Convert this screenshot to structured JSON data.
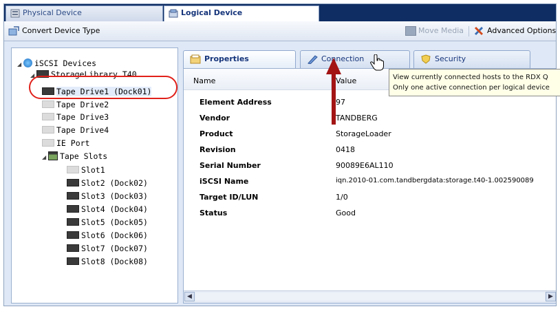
{
  "tabs": {
    "physical": "Physical Device",
    "logical": "Logical Device"
  },
  "toolbar": {
    "convert": "Convert Device Type",
    "move_media": "Move Media",
    "advanced": "Advanced Options"
  },
  "tree": {
    "root": "iSCSI Devices",
    "library": "StorageLibrary T40",
    "drive1": "Tape Drive1 (Dock01)",
    "drive2": "Tape Drive2",
    "drive3": "Tape Drive3",
    "drive4": "Tape Drive4",
    "ieport": "IE Port",
    "slots": "Tape Slots",
    "slot1": "Slot1",
    "slot2": "Slot2 (Dock02)",
    "slot3": "Slot3 (Dock03)",
    "slot4": "Slot4 (Dock04)",
    "slot5": "Slot5 (Dock05)",
    "slot6": "Slot6 (Dock06)",
    "slot7": "Slot7 (Dock07)",
    "slot8": "Slot8 (Dock08)"
  },
  "panel_tabs": {
    "properties": "Properties",
    "connection": "Connection",
    "security": "Security"
  },
  "grid": {
    "col_name": "Name",
    "col_value": "Value",
    "rows": [
      {
        "name": "Element Address",
        "value": "97"
      },
      {
        "name": "Vendor",
        "value": "TANDBERG"
      },
      {
        "name": "Product",
        "value": "StorageLoader"
      },
      {
        "name": "Revision",
        "value": "0418"
      },
      {
        "name": "Serial Number",
        "value": "90089E6AL110"
      },
      {
        "name": "iSCSI Name",
        "value": "iqn.2010-01.com.tandbergdata:storage.t40-1.002590089"
      },
      {
        "name": "Target ID/LUN",
        "value": "1/0"
      },
      {
        "name": "Status",
        "value": "Good"
      }
    ]
  },
  "tooltip": {
    "line1": "View currently connected hosts to the RDX Q",
    "line2": "Only one active connection per logical device"
  },
  "colors": {
    "accent_dark": "#0f2d63",
    "highlight_red": "#e0201a",
    "arrow_red": "#a31414"
  }
}
